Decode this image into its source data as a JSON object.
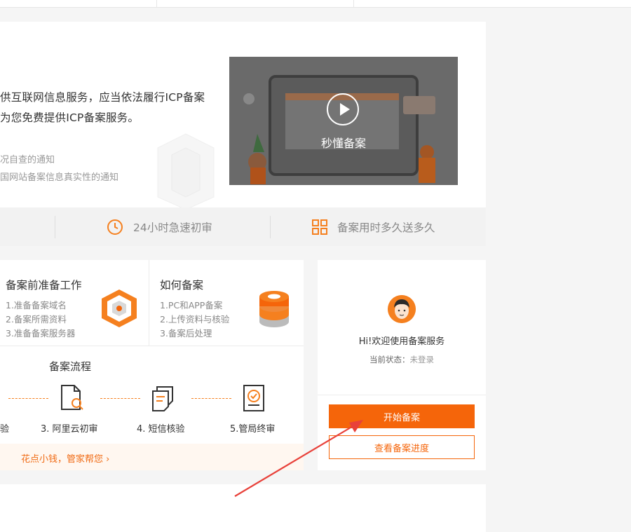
{
  "hero": {
    "line1": "供互联网信息服务，应当依法履行ICP备案",
    "line2": "为您免费提供ICP备案服务。",
    "notices": [
      "况自查的通知",
      "国网站备案信息真实性的通知"
    ],
    "video_label": "秒懂备案",
    "features": [
      "24小时急速初审",
      "备案用时多久送多久"
    ]
  },
  "prep_card": {
    "title": "备案前准备工作",
    "items": [
      "1.准备备案域名",
      "2.备案所需资料",
      "3.准备备案服务器"
    ]
  },
  "howto_card": {
    "title": "如何备案",
    "items": [
      "1.PC和APP备案",
      "2.上传资料与核验",
      "3.备案后处理"
    ]
  },
  "flow": {
    "title": "备案流程",
    "steps": [
      "验",
      "3. 阿里云初审",
      "4. 短信核验",
      "5.管局终审"
    ]
  },
  "help_link": "花点小钱，管家帮您 ›",
  "user_panel": {
    "greeting": "Hi!欢迎使用备案服务",
    "status_label": "当前状态：",
    "status_value": "未登录",
    "start_button": "开始备案",
    "progress_button": "查看备案进度"
  },
  "colors": {
    "accent": "#f5650a",
    "dash": "#f5801f",
    "link": "#f06a13"
  }
}
